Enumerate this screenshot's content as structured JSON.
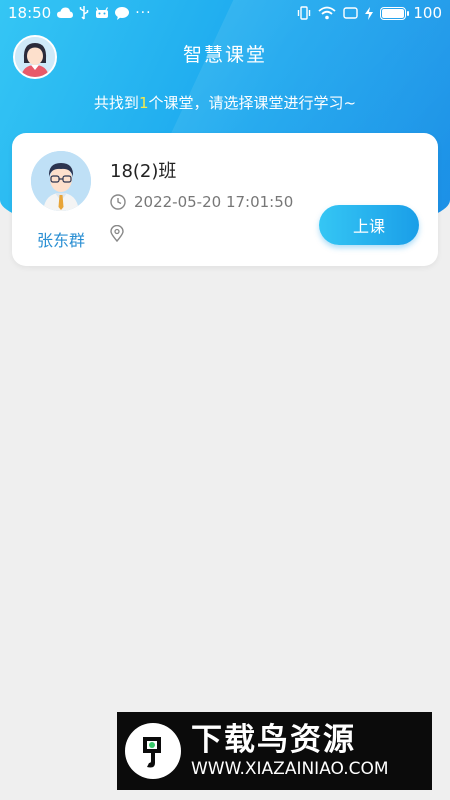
{
  "status_bar": {
    "time": "18:50",
    "battery_level": "100"
  },
  "header": {
    "title": "智慧课堂",
    "subtitle_prefix": "共找到",
    "subtitle_count": "1",
    "subtitle_suffix": "个课堂，请选择课堂进行学习~"
  },
  "classroom_card": {
    "teacher_name": "张东群",
    "class_name": "18(2)班",
    "time": "2022-05-20 17:01:50",
    "location": "",
    "button_label": "上课"
  },
  "watermark": {
    "title": "下载鸟资源",
    "url": "WWW.XIAZAINIAO.COM"
  },
  "colors": {
    "header_start": "#35c6f4",
    "header_end": "#1d8fe6",
    "teacher_name": "#2a8fd3",
    "highlight_count": "#f7e94a"
  }
}
